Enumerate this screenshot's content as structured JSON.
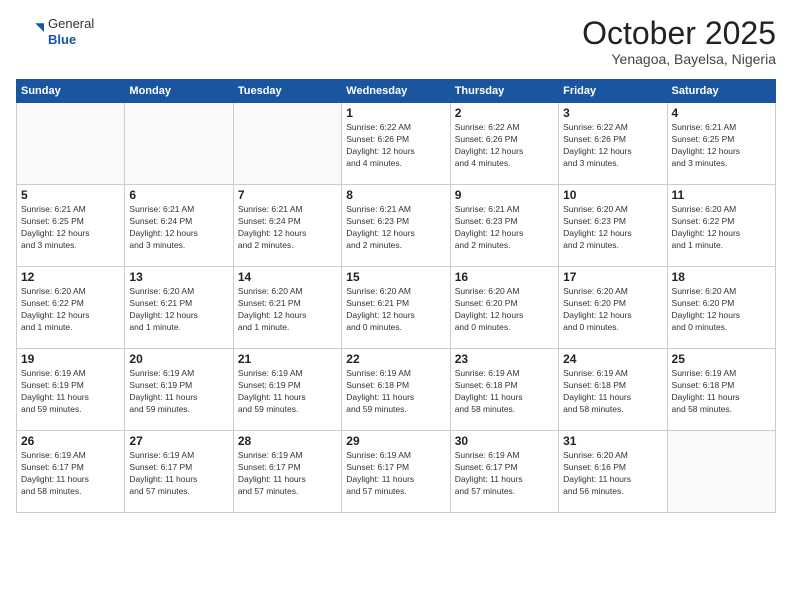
{
  "header": {
    "logo": {
      "general": "General",
      "blue": "Blue"
    },
    "title": "October 2025",
    "location": "Yenagoa, Bayelsa, Nigeria"
  },
  "weekdays": [
    "Sunday",
    "Monday",
    "Tuesday",
    "Wednesday",
    "Thursday",
    "Friday",
    "Saturday"
  ],
  "weeks": [
    [
      {
        "day": "",
        "info": ""
      },
      {
        "day": "",
        "info": ""
      },
      {
        "day": "",
        "info": ""
      },
      {
        "day": "1",
        "info": "Sunrise: 6:22 AM\nSunset: 6:26 PM\nDaylight: 12 hours\nand 4 minutes."
      },
      {
        "day": "2",
        "info": "Sunrise: 6:22 AM\nSunset: 6:26 PM\nDaylight: 12 hours\nand 4 minutes."
      },
      {
        "day": "3",
        "info": "Sunrise: 6:22 AM\nSunset: 6:26 PM\nDaylight: 12 hours\nand 3 minutes."
      },
      {
        "day": "4",
        "info": "Sunrise: 6:21 AM\nSunset: 6:25 PM\nDaylight: 12 hours\nand 3 minutes."
      }
    ],
    [
      {
        "day": "5",
        "info": "Sunrise: 6:21 AM\nSunset: 6:25 PM\nDaylight: 12 hours\nand 3 minutes."
      },
      {
        "day": "6",
        "info": "Sunrise: 6:21 AM\nSunset: 6:24 PM\nDaylight: 12 hours\nand 3 minutes."
      },
      {
        "day": "7",
        "info": "Sunrise: 6:21 AM\nSunset: 6:24 PM\nDaylight: 12 hours\nand 2 minutes."
      },
      {
        "day": "8",
        "info": "Sunrise: 6:21 AM\nSunset: 6:23 PM\nDaylight: 12 hours\nand 2 minutes."
      },
      {
        "day": "9",
        "info": "Sunrise: 6:21 AM\nSunset: 6:23 PM\nDaylight: 12 hours\nand 2 minutes."
      },
      {
        "day": "10",
        "info": "Sunrise: 6:20 AM\nSunset: 6:23 PM\nDaylight: 12 hours\nand 2 minutes."
      },
      {
        "day": "11",
        "info": "Sunrise: 6:20 AM\nSunset: 6:22 PM\nDaylight: 12 hours\nand 1 minute."
      }
    ],
    [
      {
        "day": "12",
        "info": "Sunrise: 6:20 AM\nSunset: 6:22 PM\nDaylight: 12 hours\nand 1 minute."
      },
      {
        "day": "13",
        "info": "Sunrise: 6:20 AM\nSunset: 6:21 PM\nDaylight: 12 hours\nand 1 minute."
      },
      {
        "day": "14",
        "info": "Sunrise: 6:20 AM\nSunset: 6:21 PM\nDaylight: 12 hours\nand 1 minute."
      },
      {
        "day": "15",
        "info": "Sunrise: 6:20 AM\nSunset: 6:21 PM\nDaylight: 12 hours\nand 0 minutes."
      },
      {
        "day": "16",
        "info": "Sunrise: 6:20 AM\nSunset: 6:20 PM\nDaylight: 12 hours\nand 0 minutes."
      },
      {
        "day": "17",
        "info": "Sunrise: 6:20 AM\nSunset: 6:20 PM\nDaylight: 12 hours\nand 0 minutes."
      },
      {
        "day": "18",
        "info": "Sunrise: 6:20 AM\nSunset: 6:20 PM\nDaylight: 12 hours\nand 0 minutes."
      }
    ],
    [
      {
        "day": "19",
        "info": "Sunrise: 6:19 AM\nSunset: 6:19 PM\nDaylight: 11 hours\nand 59 minutes."
      },
      {
        "day": "20",
        "info": "Sunrise: 6:19 AM\nSunset: 6:19 PM\nDaylight: 11 hours\nand 59 minutes."
      },
      {
        "day": "21",
        "info": "Sunrise: 6:19 AM\nSunset: 6:19 PM\nDaylight: 11 hours\nand 59 minutes."
      },
      {
        "day": "22",
        "info": "Sunrise: 6:19 AM\nSunset: 6:18 PM\nDaylight: 11 hours\nand 59 minutes."
      },
      {
        "day": "23",
        "info": "Sunrise: 6:19 AM\nSunset: 6:18 PM\nDaylight: 11 hours\nand 58 minutes."
      },
      {
        "day": "24",
        "info": "Sunrise: 6:19 AM\nSunset: 6:18 PM\nDaylight: 11 hours\nand 58 minutes."
      },
      {
        "day": "25",
        "info": "Sunrise: 6:19 AM\nSunset: 6:18 PM\nDaylight: 11 hours\nand 58 minutes."
      }
    ],
    [
      {
        "day": "26",
        "info": "Sunrise: 6:19 AM\nSunset: 6:17 PM\nDaylight: 11 hours\nand 58 minutes."
      },
      {
        "day": "27",
        "info": "Sunrise: 6:19 AM\nSunset: 6:17 PM\nDaylight: 11 hours\nand 57 minutes."
      },
      {
        "day": "28",
        "info": "Sunrise: 6:19 AM\nSunset: 6:17 PM\nDaylight: 11 hours\nand 57 minutes."
      },
      {
        "day": "29",
        "info": "Sunrise: 6:19 AM\nSunset: 6:17 PM\nDaylight: 11 hours\nand 57 minutes."
      },
      {
        "day": "30",
        "info": "Sunrise: 6:19 AM\nSunset: 6:17 PM\nDaylight: 11 hours\nand 57 minutes."
      },
      {
        "day": "31",
        "info": "Sunrise: 6:20 AM\nSunset: 6:16 PM\nDaylight: 11 hours\nand 56 minutes."
      },
      {
        "day": "",
        "info": ""
      }
    ]
  ]
}
